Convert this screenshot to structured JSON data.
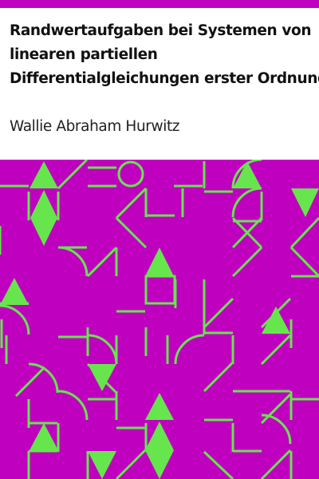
{
  "book": {
    "title_lines": [
      "Randwertaufgaben bei Systemen von",
      "linearen partiellen",
      "Differentialgleichungen erster Ordnung"
    ],
    "author": "Wallie Abraham Hurwitz"
  },
  "colors": {
    "accent": "#bf00bf",
    "pattern_background": "#bf00bf",
    "pattern_foreground": "#66e64c",
    "title_text": "#111111",
    "page_background": "#ffffff"
  }
}
